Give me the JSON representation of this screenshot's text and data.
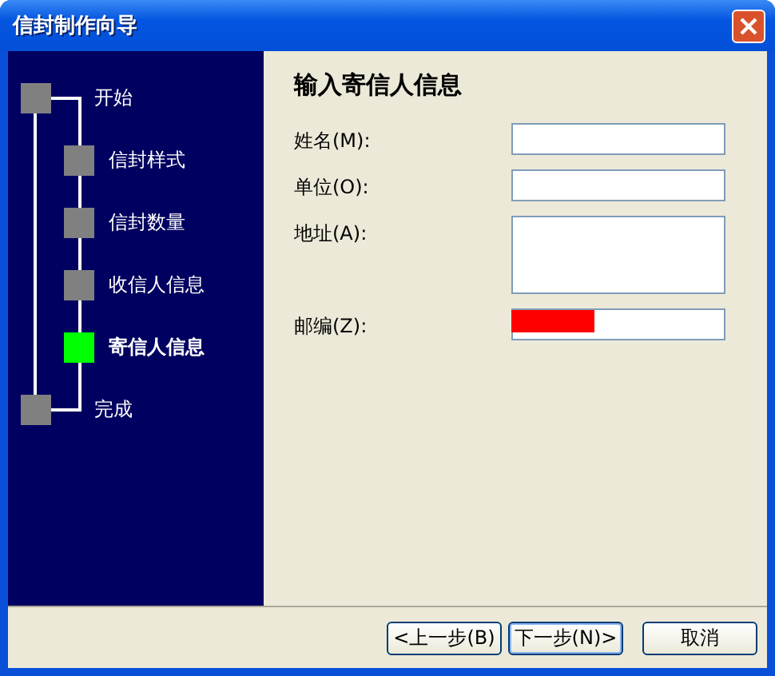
{
  "window": {
    "title": "信封制作向导"
  },
  "steps": [
    {
      "label": "开始",
      "kind": "top",
      "selected": false
    },
    {
      "label": "信封样式",
      "kind": "sub",
      "selected": false
    },
    {
      "label": "信封数量",
      "kind": "sub",
      "selected": false
    },
    {
      "label": "收信人信息",
      "kind": "sub",
      "selected": false
    },
    {
      "label": "寄信人信息",
      "kind": "sub",
      "selected": true
    },
    {
      "label": "完成",
      "kind": "top",
      "selected": false
    }
  ],
  "page": {
    "title": "输入寄信人信息"
  },
  "fields": [
    {
      "label": "姓名(M):",
      "kind": "line"
    },
    {
      "label": "单位(O):",
      "kind": "line"
    },
    {
      "label": "地址(A):",
      "kind": "area"
    },
    {
      "label": "邮编(Z):",
      "kind": "line",
      "redacted": true
    }
  ],
  "buttons": [
    {
      "label": "<上一步(B)",
      "default": false
    },
    {
      "label": "下一步(N)>",
      "default": true
    },
    {
      "label": "取消",
      "default": false
    }
  ]
}
